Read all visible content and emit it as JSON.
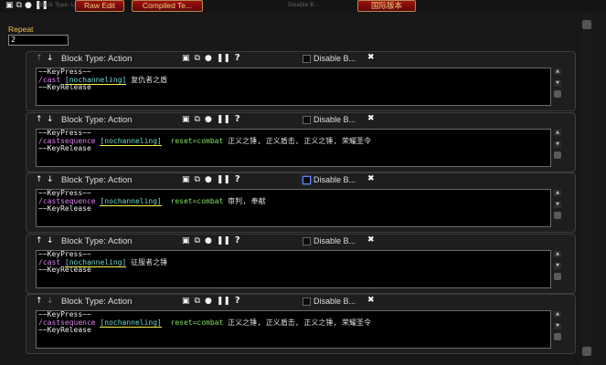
{
  "toolbar": {
    "raw_edit_label": "Raw Edit",
    "compiled_label": "Compiled Te...",
    "locale_label": "国际版本",
    "faded_left": "Block Type: Loop",
    "faded_mid": "Disable B..."
  },
  "repeat": {
    "label": "Repeat",
    "value": "2"
  },
  "block_header": {
    "type_label": "Block Type: Action",
    "disable_label": "Disable B..."
  },
  "blocks": [
    {
      "disable_highlighted": false,
      "up_enabled": false,
      "down_enabled": true,
      "lines": {
        "l1": "~~KeyPress~~",
        "cmd": "/cast ",
        "cond": "[nochanneling]",
        "reset": "",
        "spells": " 复仇者之盾",
        "l3": "~~KeyRelease"
      }
    },
    {
      "disable_highlighted": false,
      "up_enabled": true,
      "down_enabled": true,
      "lines": {
        "l1": "~~KeyPress~~",
        "cmd": "/castsequence ",
        "cond": "[nochanneling]",
        "reset": "  reset=combat",
        "spells": " 正义之锤, 正义盾击, 正义之锤, 荣耀圣令",
        "l3": "~~KeyRelease"
      }
    },
    {
      "disable_highlighted": true,
      "up_enabled": true,
      "down_enabled": true,
      "lines": {
        "l1": "~~KeyPress~~",
        "cmd": "/castsequence ",
        "cond": "[nochanneling]",
        "reset": "  reset=combat",
        "spells": " 审判, 奉献",
        "l3": "~~KeyRelease"
      }
    },
    {
      "disable_highlighted": false,
      "up_enabled": true,
      "down_enabled": true,
      "lines": {
        "l1": "~~KeyPress~~",
        "cmd": "/cast ",
        "cond": "[nochanneling]",
        "reset": "",
        "spells": " 征服者之锤",
        "l3": "~~KeyRelease"
      }
    },
    {
      "disable_highlighted": false,
      "up_enabled": true,
      "down_enabled": false,
      "lines": {
        "l1": "~~KeyPress~~",
        "cmd": "/castsequence ",
        "cond": "[nochanneling]",
        "reset": "  reset=combat",
        "spells": " 正义之锤, 正义盾击, 正义之锤, 荣耀圣令",
        "l3": "~~KeyRelease"
      }
    }
  ],
  "icons": {
    "up": "up-arrow-icon",
    "down": "down-arrow-icon",
    "grid": "grid-icon",
    "copy": "copy-icon",
    "circle": "circle-icon",
    "pause": "pause-icon",
    "help": "help-icon",
    "delete": "close-icon"
  }
}
